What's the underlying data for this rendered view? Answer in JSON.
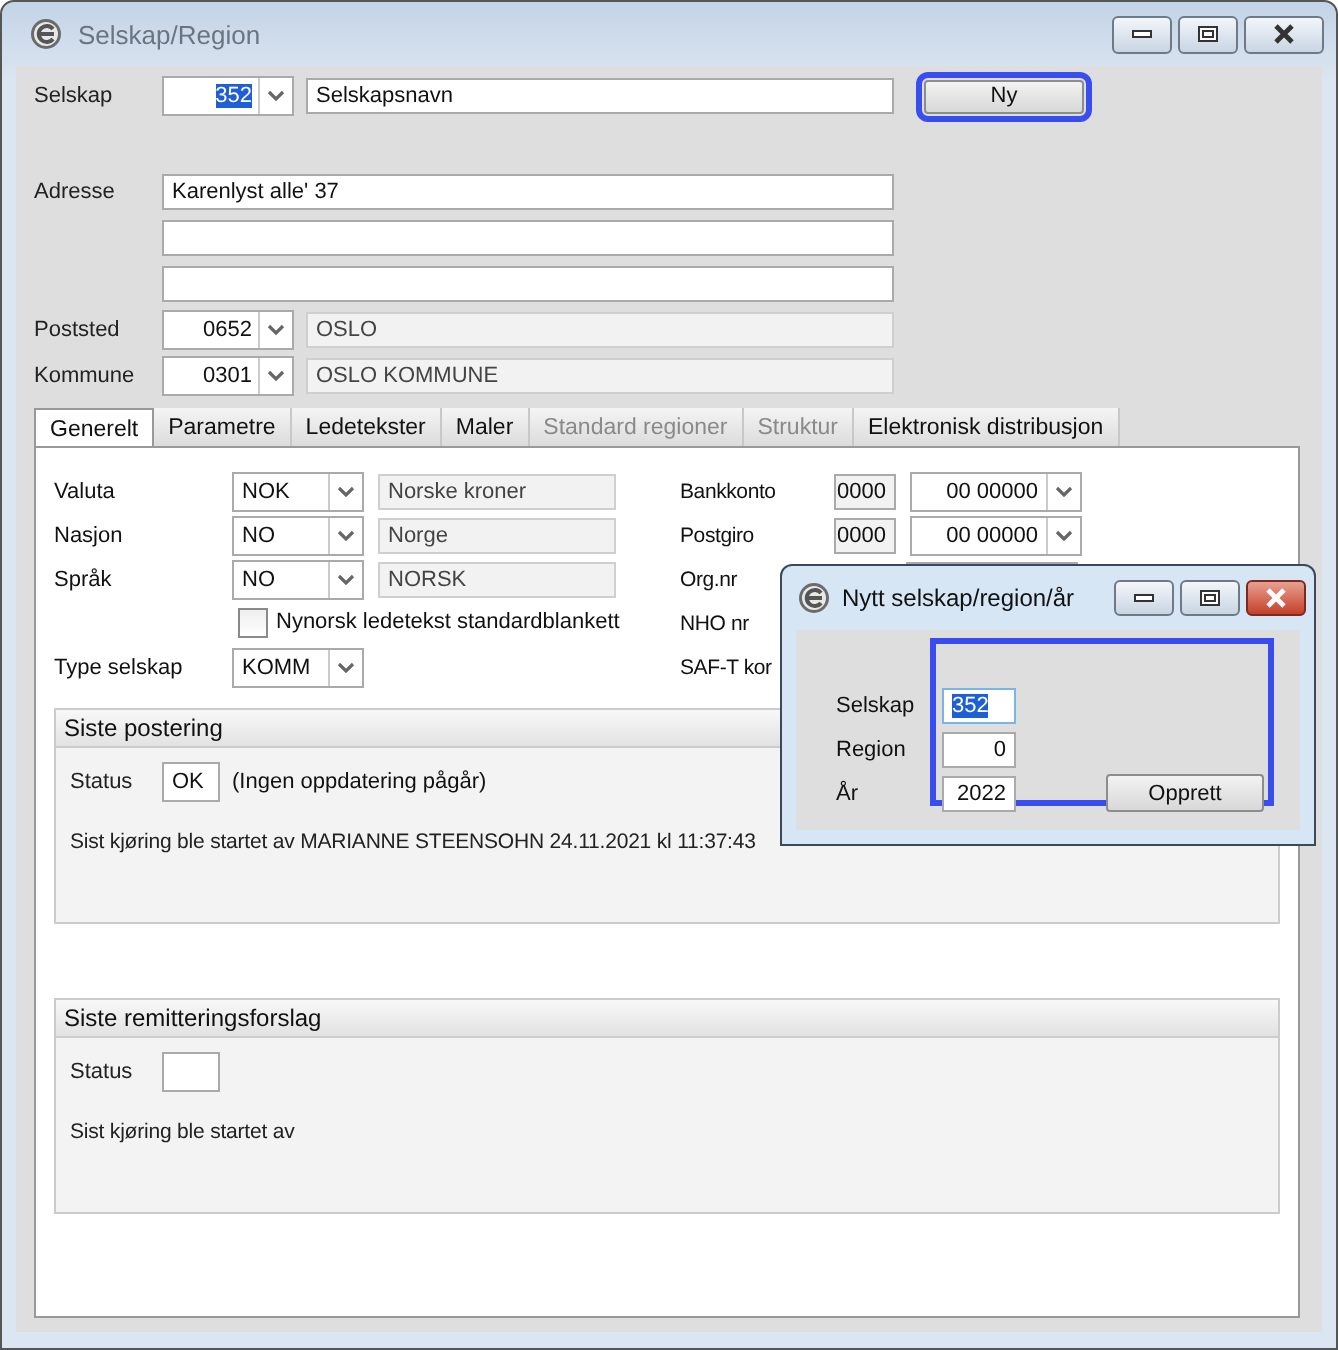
{
  "window": {
    "title": "Selskap/Region"
  },
  "selskap": {
    "label": "Selskap",
    "code": "352",
    "code_selected": true,
    "name": "Selskapsnavn"
  },
  "new_button": {
    "label": "Ny",
    "focused": true
  },
  "address": {
    "label": "Adresse",
    "lines": [
      {
        "kind": "text",
        "value": "Karenlyst alle' 37"
      },
      {
        "kind": "blank"
      },
      {
        "kind": "blank"
      }
    ]
  },
  "lookups": [
    {
      "label": "Poststed",
      "code": "0652",
      "name": "OSLO"
    },
    {
      "label": "Kommune",
      "code": "0301",
      "name": "OSLO KOMMUNE"
    }
  ],
  "tabs": [
    {
      "label": "Generelt",
      "selected": true,
      "disabled": false
    },
    {
      "label": "Parametre",
      "selected": false,
      "disabled": false
    },
    {
      "label": "Ledetekster",
      "selected": false,
      "disabled": false
    },
    {
      "label": "Maler",
      "selected": false,
      "disabled": false
    },
    {
      "label": "Standard regioner",
      "selected": false,
      "disabled": true
    },
    {
      "label": "Struktur",
      "selected": false,
      "disabled": true
    },
    {
      "label": "Elektronisk distribusjon",
      "selected": false,
      "disabled": false
    }
  ],
  "left_fields": [
    {
      "kind": "combo",
      "label": "Valuta",
      "code": "NOK",
      "name": "Norske kroner"
    },
    {
      "kind": "combo",
      "label": "Nasjon",
      "code": "NO",
      "name": "Norge"
    },
    {
      "kind": "combo",
      "label": "Språk",
      "code": "NO",
      "name": "NORSK"
    },
    {
      "kind": "checkbox",
      "label": "Nynorsk ledetekst standardblankett",
      "checked": false
    },
    {
      "kind": "combo",
      "label": "Type selskap",
      "code": "KOMM"
    }
  ],
  "right_fields": [
    {
      "kind": "account",
      "label": "Bankkonto",
      "prefix": "0000",
      "value": "00 00000"
    },
    {
      "kind": "account",
      "label": "Postgiro",
      "prefix": "0000",
      "value": "00 00000"
    },
    {
      "kind": "field",
      "label": "Org.nr"
    },
    {
      "kind": "label",
      "label": "NHO nr"
    },
    {
      "kind": "label",
      "label": "SAF-T kor"
    }
  ],
  "groups": [
    {
      "title": "Siste postering",
      "status_label": "Status",
      "status": "OK",
      "status_note": "(Ingen oppdatering pågår)",
      "info": "Sist kjøring ble startet av MARIANNE STEENSOHN 24.11.2021 kl 11:37:43"
    },
    {
      "title": "Siste remitteringsforslag",
      "status_label": "Status",
      "info": "Sist kjøring ble startet av"
    }
  ],
  "dialog": {
    "title": "Nytt selskap/region/år",
    "highlighted": true,
    "fields": [
      {
        "label": "Selskap",
        "value": "352",
        "text_selected": true
      },
      {
        "label": "Region",
        "value": "0",
        "text_selected": false
      },
      {
        "label": "År",
        "value": "2022",
        "text_selected": false
      }
    ],
    "button": {
      "label": "Opprett"
    }
  }
}
